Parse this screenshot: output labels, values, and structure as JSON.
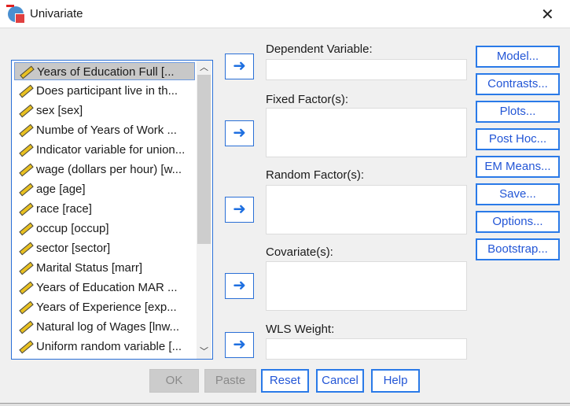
{
  "window": {
    "title": "Univariate",
    "close": "✕"
  },
  "variables": [
    "Years of Education Full [...",
    "Does participant live in th...",
    "sex [sex]",
    "Numbe of Years of Work ...",
    "Indicator variable for union...",
    "wage (dollars per hour) [w...",
    "age [age]",
    "race [race]",
    "occup [occup]",
    "sector [sector]",
    "Marital Status [marr]",
    "Years of Education MAR ...",
    "Years of Experience [exp...",
    "Natural log of Wages [lnw...",
    "Uniform random variable [..."
  ],
  "fields": {
    "dependent": "Dependent Variable:",
    "fixed": "Fixed Factor(s):",
    "random": "Random Factor(s):",
    "covariate": "Covariate(s):",
    "wls": "WLS Weight:"
  },
  "side_buttons": [
    "Model...",
    "Contrasts...",
    "Plots...",
    "Post Hoc...",
    "EM Means...",
    "Save...",
    "Options...",
    "Bootstrap..."
  ],
  "bottom_buttons": {
    "ok": "OK",
    "paste": "Paste",
    "reset": "Reset",
    "cancel": "Cancel",
    "help": "Help"
  },
  "icons": {
    "variable": "scale-ruler-icon",
    "move": "arrow-right-icon"
  },
  "accent": "#2a7ae8"
}
